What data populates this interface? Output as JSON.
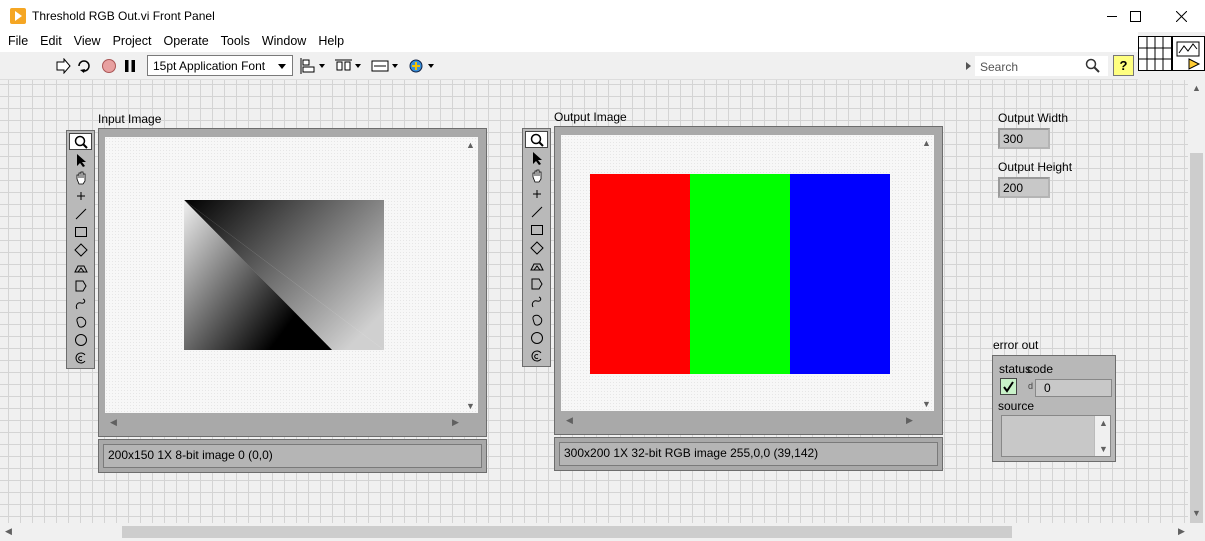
{
  "window": {
    "title": "Threshold RGB Out.vi Front Panel"
  },
  "menu": [
    "File",
    "Edit",
    "View",
    "Project",
    "Operate",
    "Tools",
    "Window",
    "Help"
  ],
  "toolbar": {
    "font": "15pt Application Font",
    "search_placeholder": "Search",
    "help_label": "?"
  },
  "input_image": {
    "label": "Input Image",
    "status": "200x150 1X 8-bit image 0    (0,0)"
  },
  "output_image": {
    "label": "Output Image",
    "status": "300x200 1X 32-bit RGB image 255,0,0    (39,142)",
    "colors": [
      "#ff0000",
      "#00ff00",
      "#0000ff"
    ]
  },
  "output_width": {
    "label": "Output Width",
    "value": "300"
  },
  "output_height": {
    "label": "Output Height",
    "value": "200"
  },
  "error_out": {
    "label": "error out",
    "status_label": "status",
    "code_label": "code",
    "code_value": "0",
    "code_increment": "d",
    "source_label": "source"
  },
  "palette_tools": [
    "zoom-icon",
    "pointer-icon",
    "pan-icon",
    "point-icon",
    "line-icon",
    "rectangle-icon",
    "rotated-rectangle-icon",
    "annulus-icon",
    "polygon-icon",
    "freehand-line-icon",
    "freehand-region-icon",
    "oval-icon",
    "rotated-annulus-icon"
  ]
}
